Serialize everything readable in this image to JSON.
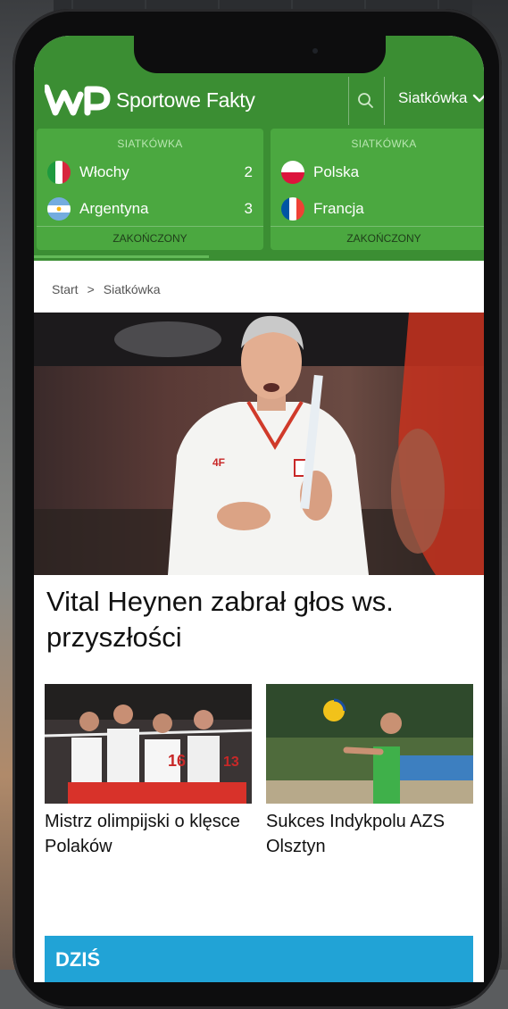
{
  "app": {
    "brand": "Sportowe Fakty"
  },
  "header": {
    "category_selected": "Siatkówka",
    "accent_color": "#3b8e33"
  },
  "scores": [
    {
      "category": "SIATKÓWKA",
      "teams": [
        {
          "name": "Włochy",
          "score": "2",
          "flag": "italy"
        },
        {
          "name": "Argentyna",
          "score": "3",
          "flag": "argentina"
        }
      ],
      "status": "ZAKOŃCZONY"
    },
    {
      "category": "SIATKÓWKA",
      "teams": [
        {
          "name": "Polska",
          "score": "",
          "flag": "poland"
        },
        {
          "name": "Francja",
          "score": "",
          "flag": "france"
        }
      ],
      "status": "ZAKOŃCZONY"
    }
  ],
  "breadcrumb": {
    "start": "Start",
    "separator": ">",
    "current": "Siatkówka"
  },
  "main_article": {
    "title": "Vital Heynen zabrał głos ws. przyszłości"
  },
  "related": [
    {
      "title": "Mistrz olimpijski o klęsce Polaków"
    },
    {
      "title": "Sukces Indykpolu AZS Olsztyn"
    }
  ],
  "section": {
    "label": "DZIŚ",
    "color": "#21a3d6"
  }
}
